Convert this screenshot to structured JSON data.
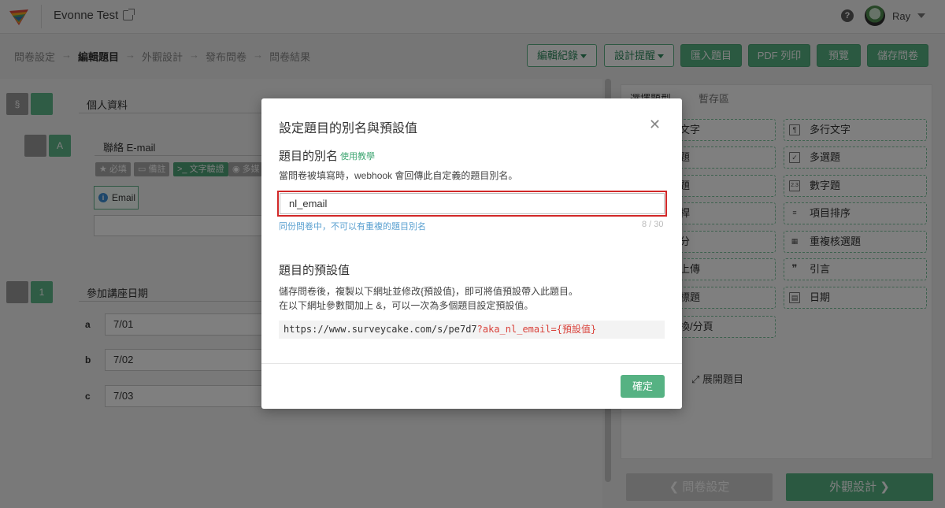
{
  "topbar": {
    "app_title": "Evonne Test",
    "help_glyph": "?",
    "user_name": "Ray"
  },
  "breadcrumb": {
    "items": [
      "問卷設定",
      "編輯題目",
      "外觀設計",
      "發布問卷",
      "問卷結果"
    ],
    "active_index": 1,
    "separator": "→"
  },
  "toolbar": {
    "edit_log": "編輯紀錄",
    "design_tips": "設計提醒",
    "import": "匯入題目",
    "pdf_print": "PDF 列印",
    "preview": "預覽",
    "save": "儲存問卷"
  },
  "editor": {
    "section_marker": "§",
    "section_title": "個人資料",
    "q1": {
      "marker": "A",
      "title": "聯絡 E-mail",
      "tags": [
        "必填",
        "備註",
        "文字驗證",
        "多媒"
      ],
      "tag_icons": [
        "★",
        "▭",
        ">_",
        "◉"
      ],
      "badge": "Email",
      "info_glyph": "i"
    },
    "q2": {
      "marker": "1",
      "title": "參加講座日期",
      "options": [
        {
          "letter": "a",
          "value": "7/01"
        },
        {
          "letter": "b",
          "value": "7/02"
        },
        {
          "letter": "c",
          "value": "7/03"
        }
      ]
    }
  },
  "right_panel": {
    "tabs": [
      "選擇題型",
      "暫存區"
    ],
    "types_left": [
      "文字",
      "題",
      "題",
      "桿",
      "分",
      "上傳",
      "標題",
      "換/分頁"
    ],
    "types_right": [
      {
        "label": "多行文字",
        "icon": "¶"
      },
      {
        "label": "多選題",
        "icon": "✓"
      },
      {
        "label": "數字題",
        "icon": "2.3"
      },
      {
        "label": "項目排序",
        "icon": "≡"
      },
      {
        "label": "重複核選題",
        "icon": "▦"
      },
      {
        "label": "引言",
        "icon": "❞"
      },
      {
        "label": "日期",
        "icon": "▤"
      }
    ],
    "expand_label": "展開題目",
    "expand_icon": "⤢",
    "prev_button": "問卷設定",
    "next_button": "外觀設計"
  },
  "modal": {
    "title": "設定題目的別名與預設值",
    "close_glyph": "✕",
    "alias_heading": "題目的別名",
    "alias_tutorial_link": "使用教學",
    "alias_description": "當問卷被填寫時，webhook 會回傳此自定義的題目別名。",
    "alias_value": "nl_email",
    "alias_hint": "同份問卷中，不可以有重複的題目別名",
    "alias_counter": "8 / 30",
    "default_heading": "題目的預設值",
    "default_description_1": "儲存問卷後，複製以下網址並修改{預設值}，即可將值預設帶入此題目。",
    "default_description_2": "在以下網址參數間加上 &，可以一次為多個題目設定預設值。",
    "url_base": "https://www.surveycake.com/s/pe7d7",
    "url_param": "?aka_nl_email={預設值}",
    "ok_button": "確定"
  },
  "colors": {
    "accent_green": "#56b283",
    "error_red": "#d12828",
    "hint_blue": "#5aa0d0"
  }
}
